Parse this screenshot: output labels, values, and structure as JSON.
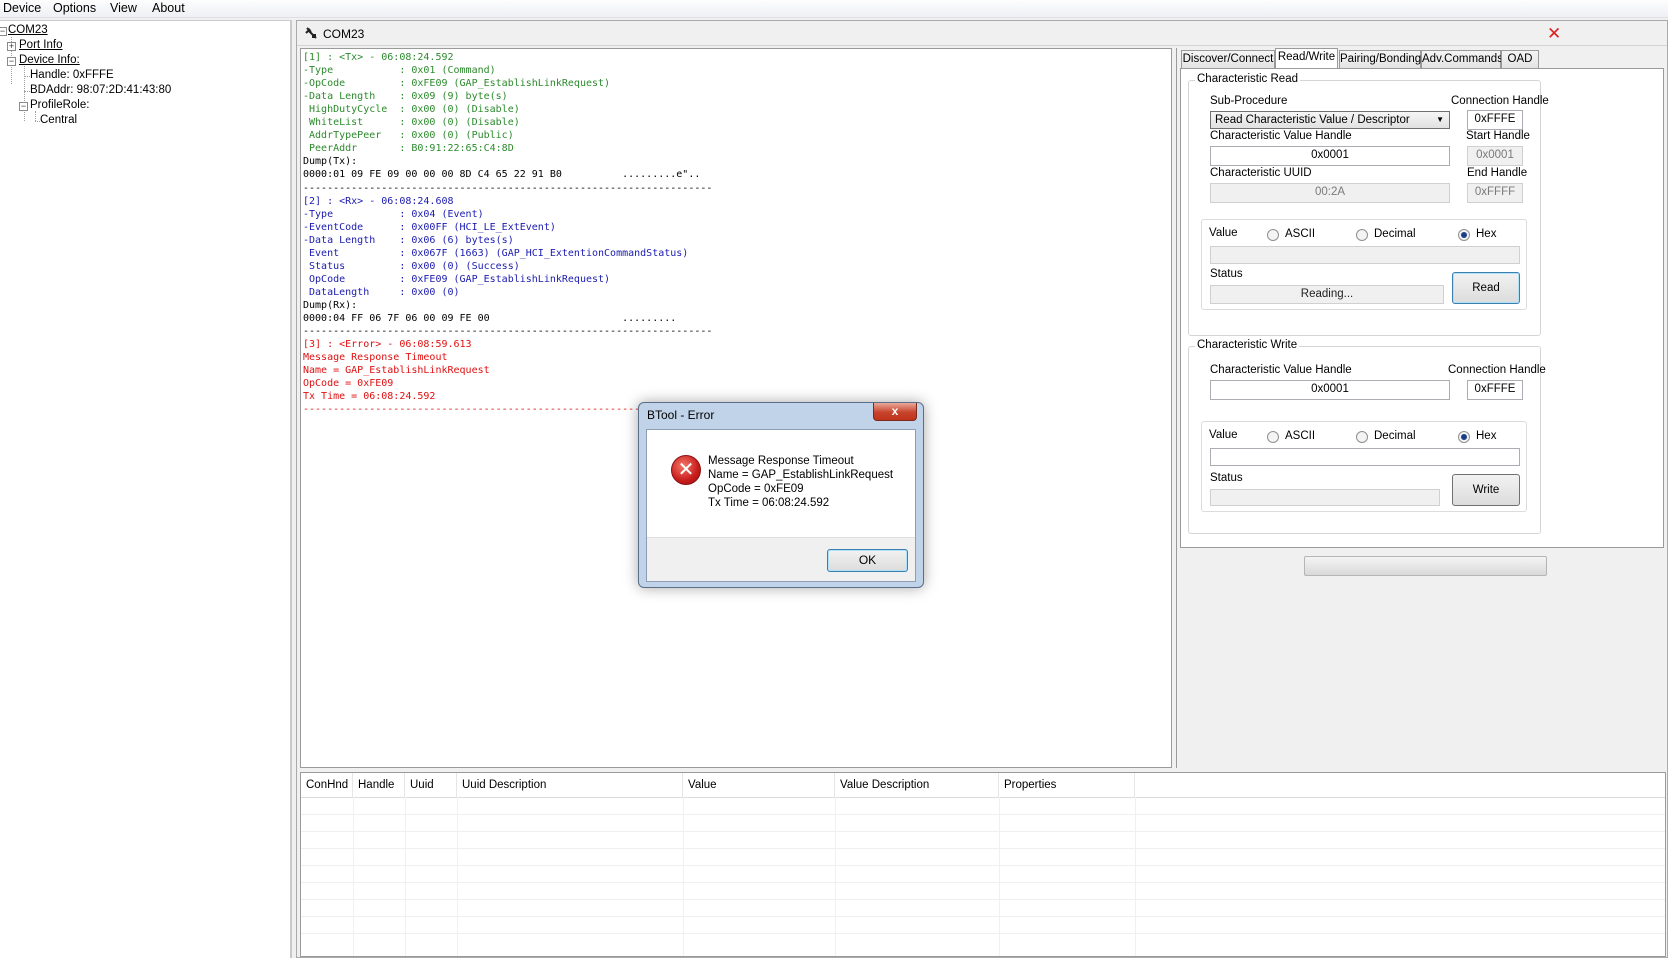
{
  "menu": {
    "items": [
      "Device",
      "Options",
      "View",
      "About"
    ]
  },
  "tree": {
    "root": "COM23",
    "port_info": "Port Info",
    "device_info": "Device Info:",
    "handle": "Handle: 0xFFFE",
    "bdaddr": "BDAddr: 98:07:2D:41:43:80",
    "profile_role": "ProfileRole:",
    "central": "Central"
  },
  "document": {
    "title": "COM23",
    "close_glyph": "✕"
  },
  "log": {
    "lines": [
      {
        "t": "[1] : <Tx> - 06:08:24.592",
        "c": "tx"
      },
      {
        "t": "-Type           : 0x01 (Command)",
        "c": "tx"
      },
      {
        "t": "-OpCode         : 0xFE09 (GAP_EstablishLinkRequest)",
        "c": "tx"
      },
      {
        "t": "-Data Length    : 0x09 (9) byte(s)",
        "c": "tx"
      },
      {
        "t": " HighDutyCycle  : 0x00 (0) (Disable)",
        "c": "tx"
      },
      {
        "t": " WhiteList      : 0x00 (0) (Disable)",
        "c": "tx"
      },
      {
        "t": " AddrTypePeer   : 0x00 (0) (Public)",
        "c": "tx"
      },
      {
        "t": " PeerAddr       : B0:91:22:65:C4:8D",
        "c": "tx"
      },
      {
        "t": "Dump(Tx):",
        "c": "dk"
      },
      {
        "t": "0000:01 09 FE 09 00 00 00 8D C4 65 22 91 B0          .........e\"..",
        "c": "dk"
      },
      {
        "t": "--------------------------------------------------------------------",
        "c": "dk"
      },
      {
        "t": "[2] : <Rx> - 06:08:24.608",
        "c": "rx"
      },
      {
        "t": "-Type           : 0x04 (Event)",
        "c": "rx"
      },
      {
        "t": "-EventCode      : 0x00FF (HCI_LE_ExtEvent)",
        "c": "rx"
      },
      {
        "t": "-Data Length    : 0x06 (6) bytes(s)",
        "c": "rx"
      },
      {
        "t": " Event          : 0x067F (1663) (GAP_HCI_ExtentionCommandStatus)",
        "c": "rx"
      },
      {
        "t": " Status         : 0x00 (0) (Success)",
        "c": "rx"
      },
      {
        "t": " OpCode         : 0xFE09 (GAP_EstablishLinkRequest)",
        "c": "rx"
      },
      {
        "t": " DataLength     : 0x00 (0)",
        "c": "rx"
      },
      {
        "t": "Dump(Rx):",
        "c": "dk"
      },
      {
        "t": "0000:04 FF 06 7F 06 00 09 FE 00                      .........",
        "c": "dk"
      },
      {
        "t": "--------------------------------------------------------------------",
        "c": "dk"
      },
      {
        "t": "[3] : <Error> - 06:08:59.613",
        "c": "er"
      },
      {
        "t": "Message Response Timeout",
        "c": "er"
      },
      {
        "t": "Name = GAP_EstablishLinkRequest",
        "c": "er"
      },
      {
        "t": "OpCode = 0xFE09",
        "c": "er"
      },
      {
        "t": "Tx Time = 06:08:24.592",
        "c": "er"
      },
      {
        "t": "--------------------------------------------------------------------",
        "c": "er"
      }
    ]
  },
  "tabs": [
    "Discover/Connect",
    "Read/Write",
    "Pairing/Bonding",
    "Adv.Commands",
    "OAD"
  ],
  "active_tab": "Read/Write",
  "char_read": {
    "title": "Characteristic Read",
    "sub_procedure_label": "Sub-Procedure",
    "sub_procedure_value": "Read Characteristic Value / Descriptor",
    "conn_handle_label": "Connection Handle",
    "conn_handle_value": "0xFFFE",
    "value_handle_label": "Characteristic Value Handle",
    "value_handle_value": "0x0001",
    "start_handle_label": "Start Handle",
    "start_handle_value": "0x0001",
    "uuid_label": "Characteristic UUID",
    "uuid_value": "00:2A",
    "end_handle_label": "End Handle",
    "end_handle_value": "0xFFFF",
    "value_label": "Value",
    "radio_ascii": "ASCII",
    "radio_decimal": "Decimal",
    "radio_hex": "Hex",
    "status_label": "Status",
    "status_value": "Reading...",
    "button": "Read"
  },
  "char_write": {
    "title": "Characteristic Write",
    "value_handle_label": "Characteristic Value Handle",
    "value_handle_value": "0x0001",
    "conn_handle_label": "Connection Handle",
    "conn_handle_value": "0xFFFE",
    "value_label": "Value",
    "radio_ascii": "ASCII",
    "radio_decimal": "Decimal",
    "radio_hex": "Hex",
    "status_label": "Status",
    "button": "Write"
  },
  "grid": {
    "columns": [
      "ConHnd",
      "Handle",
      "Uuid",
      "Uuid Description",
      "Value",
      "Value Description",
      "Properties"
    ]
  },
  "dialog": {
    "title": "BTool - Error",
    "close": "x",
    "lines": [
      "Message Response Timeout",
      "Name = GAP_EstablishLinkRequest",
      "OpCode = 0xFE09",
      "Tx Time = 06:08:24.592"
    ],
    "ok": "OK"
  }
}
